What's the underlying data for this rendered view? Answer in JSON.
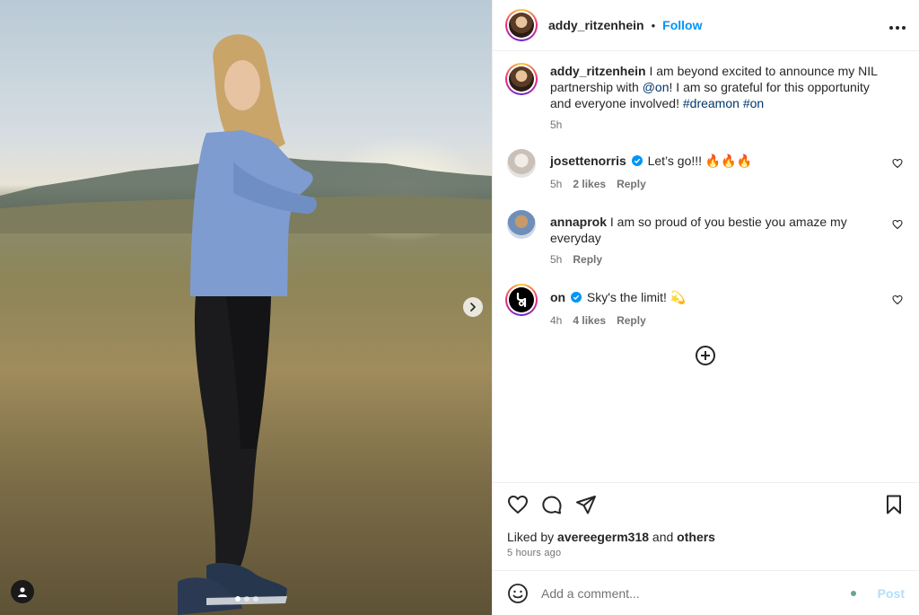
{
  "post": {
    "author": "addy_ritzenhein",
    "separator": "•",
    "follow_label": "Follow",
    "more_icon": "more-horizontal-icon",
    "photo": {
      "carousel_next_icon": "chevron-right-icon",
      "tag_icon": "user-tag-icon",
      "slide_count": 3,
      "active_slide": 1
    }
  },
  "caption": {
    "username": "addy_ritzenhein",
    "text_1": " I am beyond excited to announce my NIL partnership with ",
    "mention": "@on",
    "text_2": "! I am so grateful for this opportunity and everyone involved! ",
    "hashtag_1": "#dreamon",
    "hashtag_2": "#on",
    "time": "5h"
  },
  "comments": [
    {
      "username": "josettenorris",
      "verified": true,
      "text": "Let’s go!!! 🔥🔥🔥",
      "time": "5h",
      "likes": "2 likes",
      "reply": "Reply"
    },
    {
      "username": "annaprok",
      "verified": false,
      "text": "I am so proud of you bestie you amaze my everyday",
      "time": "5h",
      "reply": "Reply"
    },
    {
      "username": "on",
      "verified": true,
      "text": "Sky's the limit! 💫",
      "time": "4h",
      "likes": "4 likes",
      "reply": "Reply"
    }
  ],
  "load_more_icon": "plus-circle-icon",
  "actions": {
    "like_icon": "heart-icon",
    "comment_icon": "comment-icon",
    "share_icon": "send-icon",
    "save_icon": "bookmark-icon",
    "liked_by_prefix": "Liked by ",
    "liked_by_user": "avereegerm318",
    "liked_by_and": " and ",
    "liked_by_others": "others",
    "timestamp": "5 hours ago"
  },
  "add_comment": {
    "emoji_icon": "emoji-icon",
    "placeholder": "Add a comment...",
    "post_label": "Post"
  },
  "colors": {
    "follow": "#0095f6",
    "link": "#00376b",
    "verified": "#0095f6",
    "post_disabled": "#b2dffc"
  }
}
